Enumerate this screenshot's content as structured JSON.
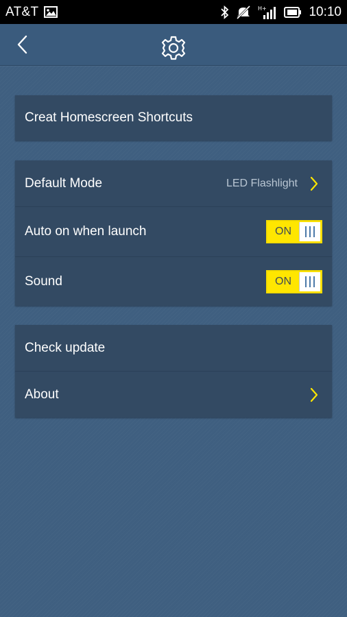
{
  "status_bar": {
    "carrier": "AT&T",
    "time": "10:10",
    "network": "H+"
  },
  "colors": {
    "accent_yellow": "#ffe600",
    "card_bg": "#334a63",
    "page_bg": "#3f5f80",
    "secondary_text": "#b9c6d3"
  },
  "icons": {
    "back": "chevron-left-icon",
    "header": "gear-icon"
  },
  "groups": {
    "shortcuts": {
      "create_label": "Creat Homescreen Shortcuts"
    },
    "preferences": {
      "default_mode_label": "Default Mode",
      "default_mode_value": "LED Flashlight",
      "auto_on_label": "Auto on when launch",
      "auto_on_state": "ON",
      "sound_label": "Sound",
      "sound_state": "ON"
    },
    "info": {
      "check_update_label": "Check update",
      "about_label": "About"
    }
  }
}
